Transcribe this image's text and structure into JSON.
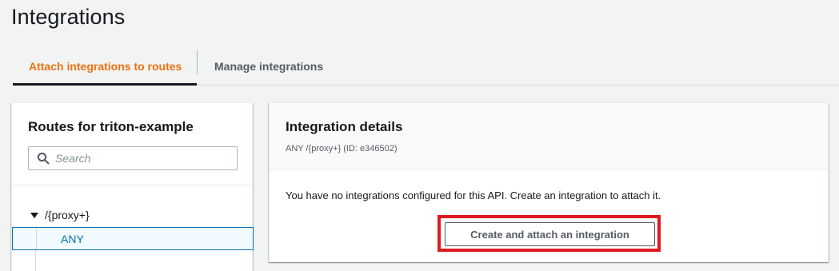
{
  "page": {
    "title": "Integrations"
  },
  "tabs": [
    {
      "label": "Attach integrations to routes",
      "active": true
    },
    {
      "label": "Manage integrations",
      "active": false
    }
  ],
  "routes": {
    "title": "Routes for triton-example",
    "search": {
      "placeholder": "Search",
      "value": ""
    },
    "tree": [
      {
        "path": "/{proxy+}",
        "expanded": true,
        "methods": [
          {
            "label": "ANY",
            "selected": true
          }
        ]
      }
    ]
  },
  "details": {
    "title": "Integration details",
    "subtitle": "ANY /{proxy+} (ID: e346502)",
    "message": "You have no integrations configured for this API. Create an integration to attach it.",
    "create_button_label": "Create and attach an integration"
  },
  "colors": {
    "accent": "#ec7211",
    "link": "#0073bb",
    "highlight": "#e0191f"
  },
  "icons": {
    "search": "search-icon",
    "caret": "caret-down-icon"
  }
}
